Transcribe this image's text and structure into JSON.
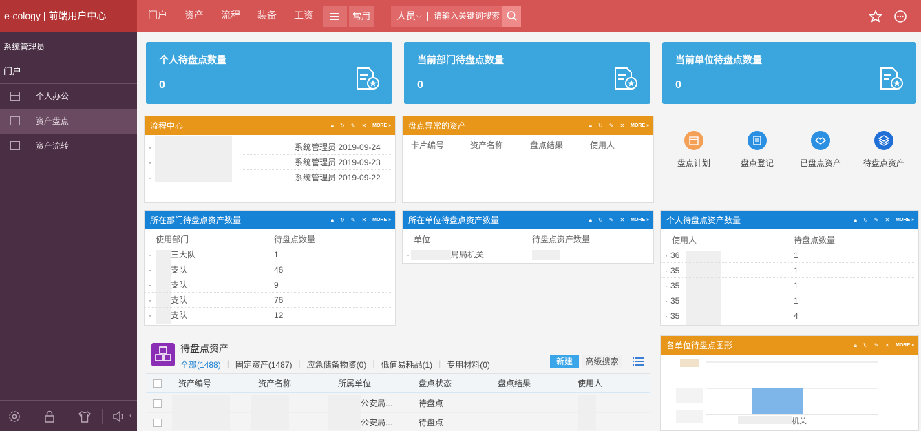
{
  "brand": "e-cology | 前端用户中心",
  "top_nav": [
    "门户",
    "资产",
    "流程",
    "装备",
    "工资"
  ],
  "common_label": "常用",
  "search": {
    "scope": "人员",
    "placeholder": "请输入关键词搜索"
  },
  "sidebar": {
    "user": "系统管理员",
    "portal": "门户",
    "items": [
      {
        "label": "个人办公"
      },
      {
        "label": "资产盘点"
      },
      {
        "label": "资产流转"
      }
    ]
  },
  "stat_cards": [
    {
      "title": "个人待盘点数量",
      "value": "0"
    },
    {
      "title": "当前部门待盘点数量",
      "value": "0"
    },
    {
      "title": "当前单位待盘点数量",
      "value": "0"
    }
  ],
  "more_label": "MORE »",
  "workflow": {
    "title": "流程中心",
    "rows": [
      {
        "meta": "系统管理员 2019-09-24"
      },
      {
        "meta": "系统管理员 2019-09-23"
      },
      {
        "meta": "系统管理员 2019-09-22"
      }
    ]
  },
  "abnormal": {
    "title": "盘点异常的资产",
    "headers": [
      "卡片编号",
      "资产名称",
      "盘点结果",
      "使用人"
    ]
  },
  "quick_icons": [
    {
      "label": "盘点计划",
      "color": "#f5a057"
    },
    {
      "label": "盘点登记",
      "color": "#2b8fe2"
    },
    {
      "label": "已盘点资产",
      "color": "#2b8fe2"
    },
    {
      "label": "待盘点资产",
      "color": "#1f6fd6"
    }
  ],
  "dept_pending": {
    "title": "所在部门待盘点资产数量",
    "headers": [
      "使用部门",
      "待盘点数量"
    ],
    "rows": [
      {
        "dept": "三大队",
        "count": "1"
      },
      {
        "dept": "支队",
        "count": "46"
      },
      {
        "dept": "支队",
        "count": "9"
      },
      {
        "dept": "支队",
        "count": "76"
      },
      {
        "dept": "支队",
        "count": "12"
      }
    ]
  },
  "unit_pending": {
    "title": "所在单位待盘点资产数量",
    "headers": [
      "单位",
      "待盘点资产数量"
    ],
    "rows": [
      {
        "unit": "局局机关",
        "count": ""
      }
    ]
  },
  "personal_pending": {
    "title": "个人待盘点资产数量",
    "headers": [
      "使用人",
      "待盘点数量"
    ],
    "rows": [
      {
        "user": "36",
        "count": "1"
      },
      {
        "user": "35",
        "count": "1"
      },
      {
        "user": "35",
        "count": "1"
      },
      {
        "user": "35",
        "count": "1"
      },
      {
        "user": "35",
        "count": "4"
      }
    ]
  },
  "assets": {
    "title": "待盘点资产",
    "filters": [
      {
        "label": "全部(1488)",
        "active": true
      },
      {
        "label": "固定资产(1487)",
        "active": false
      },
      {
        "label": "应急储备物资(0)",
        "active": false
      },
      {
        "label": "低值易耗品(1)",
        "active": false
      },
      {
        "label": "专用材料(0)",
        "active": false
      }
    ],
    "new_label": "新建",
    "advanced_label": "高级搜索",
    "headers": [
      "资产编号",
      "资产名称",
      "所属单位",
      "盘点状态",
      "盘点结果",
      "使用人"
    ],
    "rows": [
      {
        "unit": "公安局...",
        "status": "待盘点"
      },
      {
        "unit": "公安局...",
        "status": "待盘点"
      }
    ]
  },
  "chart_panel": {
    "title": "各单位待盘点图形",
    "x_label": "机关"
  },
  "chart_data": {
    "type": "bar",
    "title": "",
    "categories": [
      ""
    ],
    "values": [
      1
    ],
    "color": "#7fb6ea"
  },
  "colors": {
    "topbar": "#d55454",
    "sidebar": "#4a2e43",
    "stat_card": "#3ba5dd",
    "orange_header": "#e8961a",
    "blue_header": "#1783d6"
  }
}
